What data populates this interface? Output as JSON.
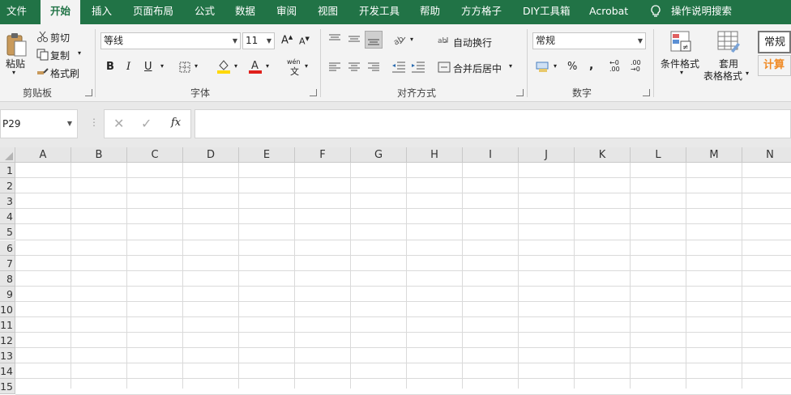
{
  "tabs": [
    "文件",
    "开始",
    "插入",
    "页面布局",
    "公式",
    "数据",
    "审阅",
    "视图",
    "开发工具",
    "帮助",
    "方方格子",
    "DIY工具箱",
    "Acrobat",
    "操作说明搜索"
  ],
  "clipboard": {
    "paste": "粘贴",
    "cut": "剪切",
    "copy": "复制",
    "format_painter": "格式刷",
    "label": "剪贴板"
  },
  "font": {
    "name": "等线",
    "size": "11",
    "bold": "B",
    "italic": "I",
    "underline": "U",
    "label": "字体",
    "phonetic": "wén"
  },
  "alignment": {
    "wrap_text": "自动换行",
    "merge_center": "合并后居中",
    "label": "对齐方式"
  },
  "number": {
    "format": "常规",
    "label": "数字"
  },
  "styles": {
    "conditional_format_line1": "条件格式",
    "table_format_line1": "套用",
    "table_format_line2": "表格格式",
    "style_normal": "常规",
    "style_calc": "计算"
  },
  "formula_bar": {
    "name_box": "P29",
    "fx": "fx"
  },
  "columns": [
    "A",
    "B",
    "C",
    "D",
    "E",
    "F",
    "G",
    "H",
    "I",
    "J",
    "K",
    "L",
    "M",
    "N"
  ],
  "rows": [
    "1",
    "2",
    "3",
    "4",
    "5",
    "6",
    "7",
    "8",
    "9",
    "10",
    "11",
    "12",
    "13",
    "14",
    "15"
  ],
  "colors": {
    "brand": "#217346",
    "font_color": "#e0201b",
    "fill_color": "#ffd800"
  }
}
